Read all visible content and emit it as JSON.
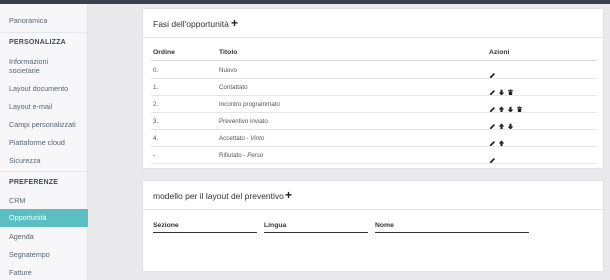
{
  "sidebar": {
    "items_top": [
      {
        "label": "Panoramica"
      }
    ],
    "section1": "PERSONALIZZA",
    "personalizza": [
      {
        "label": "Informazioni"
      },
      {
        "label": "societarie"
      },
      {
        "label": "Layout documento"
      },
      {
        "label": "Layout e-mail"
      },
      {
        "label": "Campi personalizzati"
      },
      {
        "label": "Piattaforme cloud"
      },
      {
        "label": "Sicurezza"
      }
    ],
    "section2": "PREFERENZE",
    "preferenze": [
      {
        "label": "CRM"
      },
      {
        "label": "Opportunità"
      },
      {
        "label": "Agenda"
      },
      {
        "label": "Segnatempo"
      },
      {
        "label": "Fatture"
      }
    ]
  },
  "phases": {
    "title": "Fasi dell'opportunità",
    "headers": {
      "order": "Ordine",
      "title": "Titolo",
      "actions": "Azioni"
    },
    "rows": [
      {
        "order": "0.",
        "title": "Nuovo",
        "suffix": "",
        "icons": [
          "pencil-icon"
        ]
      },
      {
        "order": "1.",
        "title": "Contattato",
        "suffix": "",
        "icons": [
          "pencil-icon",
          "arrow-down-icon",
          "trash-icon"
        ]
      },
      {
        "order": "2.",
        "title": "Incontro programmato",
        "suffix": "",
        "icons": [
          "pencil-icon",
          "arrow-up-icon",
          "arrow-down-icon",
          "trash-icon"
        ]
      },
      {
        "order": "3.",
        "title": "Preventivo inviato",
        "suffix": "",
        "icons": [
          "pencil-icon",
          "arrow-up-icon",
          "arrow-down-icon"
        ]
      },
      {
        "order": "4.",
        "title": "Accettato - ",
        "suffix": "Vinto",
        "icons": [
          "pencil-icon",
          "arrow-up-icon"
        ]
      },
      {
        "order": "-",
        "title": "Rifiutato - ",
        "suffix": "Perso",
        "icons": [
          "pencil-icon"
        ]
      }
    ]
  },
  "quote_model": {
    "title": "modello per il layout del preventivo",
    "headers": {
      "section": "Sezione",
      "language": "Lingua",
      "name": "Nome"
    }
  }
}
